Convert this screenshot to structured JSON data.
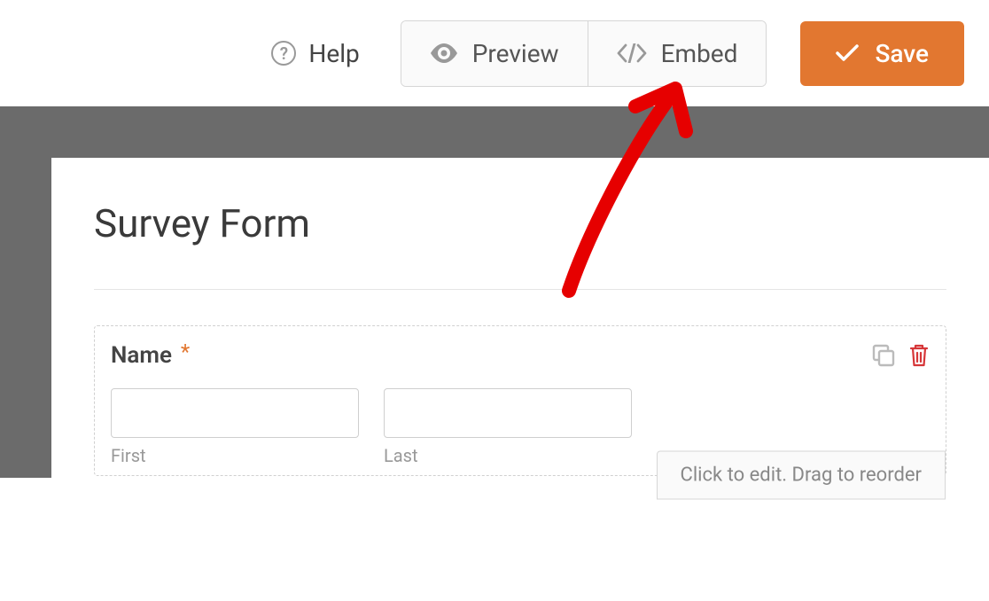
{
  "toolbar": {
    "help_label": "Help",
    "preview_label": "Preview",
    "embed_label": "Embed",
    "save_label": "Save"
  },
  "form": {
    "title": "Survey Form",
    "name_field": {
      "label": "Name",
      "required_marker": "*",
      "first_sublabel": "First",
      "last_sublabel": "Last"
    },
    "hint_text": "Click to edit. Drag to reorder"
  },
  "colors": {
    "accent": "#e27730",
    "danger": "#d63638"
  }
}
